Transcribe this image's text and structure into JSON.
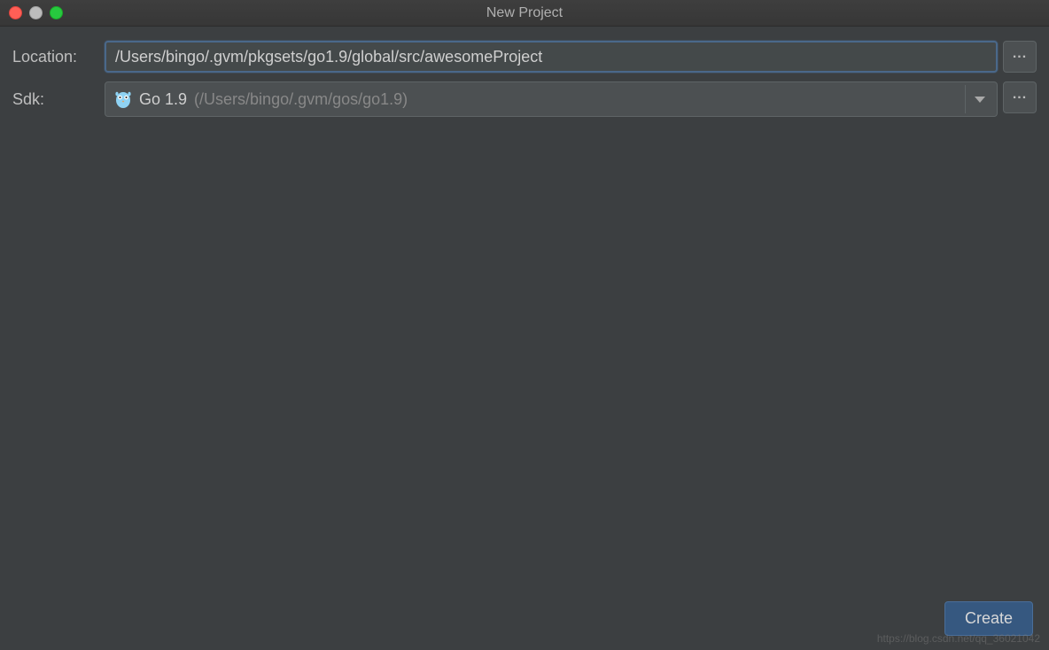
{
  "window": {
    "title": "New Project"
  },
  "form": {
    "location_label": "Location:",
    "location_value": "/Users/bingo/.gvm/pkgsets/go1.9/global/src/awesomeProject",
    "sdk_label": "Sdk:",
    "sdk_icon": "gopher-icon",
    "sdk_name": "Go 1.9",
    "sdk_path": "(/Users/bingo/.gvm/gos/go1.9)",
    "browse_label": "...",
    "dropdown_icon": "chevron-down"
  },
  "actions": {
    "create_label": "Create"
  },
  "watermark": "https://blog.csdn.net/qq_36021042"
}
